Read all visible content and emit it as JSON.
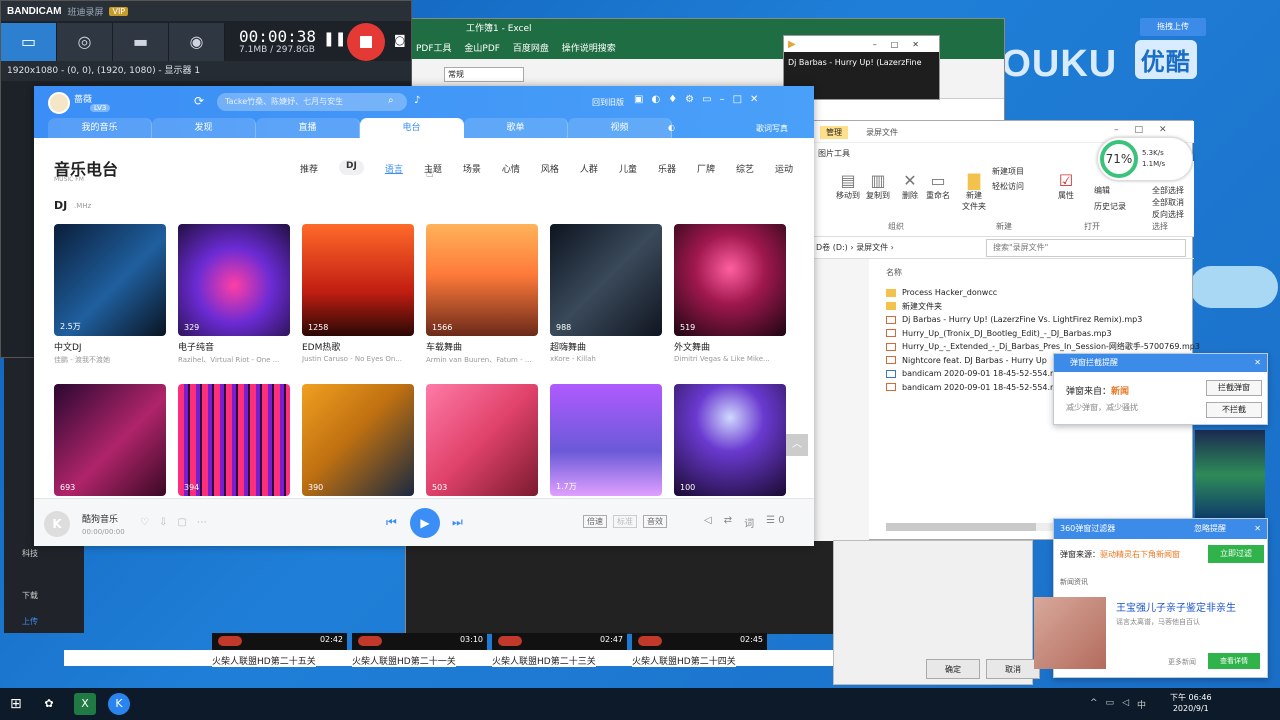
{
  "desktop": {
    "youku_brand": "YOUKU",
    "youku_cn": "优酷",
    "kuaichuan": "拖拽上传"
  },
  "excel": {
    "title": "工作簿1 - Excel",
    "menus": [
      "PDF工具",
      "金山PDF",
      "百度网盘",
      "操作说明搜索"
    ],
    "font_combo": "常规"
  },
  "bandicam": {
    "logo": "BANDICAM",
    "subtitle": "班迪录屏",
    "vip": "VIP",
    "timer": "00:00:38",
    "size": "7.1MB / 297.8GB",
    "info": "1920x1080 - (0, 0), (1920, 1080) - 显示器 1"
  },
  "kugou": {
    "user": "蔷薇",
    "level": "LV3",
    "search_placeholder": "Tacke竹桑、陈婕妤、七月与安生",
    "login_text": "回到旧版",
    "tabs": [
      "我的音乐",
      "发现",
      "直播",
      "电台",
      "歌单",
      "视频"
    ],
    "active_tab": "电台",
    "mini_mode": "歌词写真",
    "page_title": "音乐电台",
    "page_title_en": "MUSIC FM",
    "categories": [
      "推荐",
      "DJ",
      "语言",
      "主题",
      "场景",
      "心情",
      "风格",
      "人群",
      "儿童",
      "乐器",
      "厂牌",
      "综艺",
      "运动"
    ],
    "active_category": "DJ",
    "section_title": "DJ",
    "section_sub": ".MHz",
    "cards_row1": [
      {
        "count": "2.5万",
        "name": "中文DJ",
        "artist": "佳鹏 - 渡我不渡她"
      },
      {
        "count": "329",
        "name": "电子纯音",
        "artist": "Razihel、Virtual Riot - One ..."
      },
      {
        "count": "1258",
        "name": "EDM热歌",
        "artist": "Justin Caruso - No Eyes On..."
      },
      {
        "count": "1566",
        "name": "车载舞曲",
        "artist": "Armin van Buuren、Fatum - ..."
      },
      {
        "count": "988",
        "name": "超嗨舞曲",
        "artist": "xKore - Killah"
      },
      {
        "count": "519",
        "name": "外文舞曲",
        "artist": "Dimitri Vegas & Like Mike..."
      }
    ],
    "cards_row2": [
      {
        "count": "693"
      },
      {
        "count": "394"
      },
      {
        "count": "390"
      },
      {
        "count": "503"
      },
      {
        "count": "1.7万"
      },
      {
        "count": "100"
      }
    ],
    "player": {
      "song": "酷狗音乐",
      "time": "00:00/00:00",
      "tag1": "倍速",
      "tag2": "标准",
      "tag3": "音效",
      "lyric": "词",
      "queue_count": "0"
    }
  },
  "media_player": {
    "title": "Dj Barbas - Hurry Up! (LazerzFine"
  },
  "explorer": {
    "manage": "管理",
    "tab_title": "录屏文件",
    "picture_tools": "图片工具",
    "ribbon": {
      "move_to": "移动到",
      "copy_to": "复制到",
      "delete": "删除",
      "rename": "重命名",
      "new_folder": "新建\n文件夹",
      "new_item": "新建项目",
      "easy_access": "轻松访问",
      "properties": "属性",
      "open": "打开",
      "edit": "编辑",
      "history": "历史记录",
      "select_all": "全部选择",
      "select_none": "全部取消",
      "invert": "反向选择",
      "group_organize": "组织",
      "group_new": "新建",
      "group_open": "打开",
      "group_select": "选择"
    },
    "path": "D卷 (D:)  ›  录屏文件  ›",
    "search_placeholder": "搜索\"录屏文件\"",
    "col_name": "名称",
    "files": [
      {
        "name": "Process Hacker_donwcc",
        "type": "folder"
      },
      {
        "name": "新建文件夹",
        "type": "folder"
      },
      {
        "name": "Dj Barbas - Hurry Up! (LazerzFine Vs. LightFirez Remix).mp3",
        "type": "mp3"
      },
      {
        "name": "Hurry_Up_(Tronix_DJ_Bootleg_Edit)_-_DJ_Barbas.mp3",
        "type": "mp3"
      },
      {
        "name": "Hurry_Up_-_Extended_-_Dj_Barbas_Pres_In_Session-网络歌手-5700769.mp3",
        "type": "mp3"
      },
      {
        "name": "Nightcore feat. DJ Barbas - Hurry Up",
        "type": "mp3"
      },
      {
        "name": "bandicam 2020-09-01 18-45-52-554.mp4",
        "type": "mp4"
      },
      {
        "name": "bandicam 2020-09-01 18-45-52-554.mp3",
        "type": "mp3"
      }
    ],
    "ok": "确定",
    "cancel": "取消"
  },
  "speed_widget": {
    "percent": "71%",
    "up": "5.3K/s",
    "down": "1.1M/s"
  },
  "popup1": {
    "title": "弹窗拦截提醒",
    "source_label": "弹窗来自：",
    "source": "新闻",
    "sub": "减少弹窗，减少骚扰",
    "btn_block": "拦截弹窗",
    "btn_allow": "不拦截"
  },
  "popup2": {
    "title": "360弹窗过滤器",
    "ignore": "忽略提醒",
    "source_label": "弹窗来源：",
    "source": "驱动精灵右下角新闻窗",
    "filter_btn": "立即过滤",
    "news_label": "新闻资讯",
    "news_title": "王宝强儿子亲子鉴定非亲生",
    "news_sub": "谣言太离谱，马蓉他自百认",
    "more": "更多新闻",
    "view": "查看详情"
  },
  "thumbnails": [
    {
      "dur": "02:42",
      "caption": "火柴人联盟HD第二十五关"
    },
    {
      "dur": "03:10",
      "caption": "火柴人联盟HD第二十一关"
    },
    {
      "dur": "02:47",
      "caption": "火柴人联盟HD第二十三关"
    },
    {
      "dur": "02:45",
      "caption": "火柴人联盟HD第二十四关"
    }
  ],
  "side_panel": {
    "items": [
      "科技",
      "下载",
      "上传"
    ],
    "active": "上传"
  },
  "taskbar": {
    "time": "下午 06:46",
    "date": "2020/9/1"
  },
  "colors": {
    "kugou_blue": "#3a8ef6",
    "bandicam_rec": "#e53935",
    "popup_green": "#2fb34a"
  }
}
